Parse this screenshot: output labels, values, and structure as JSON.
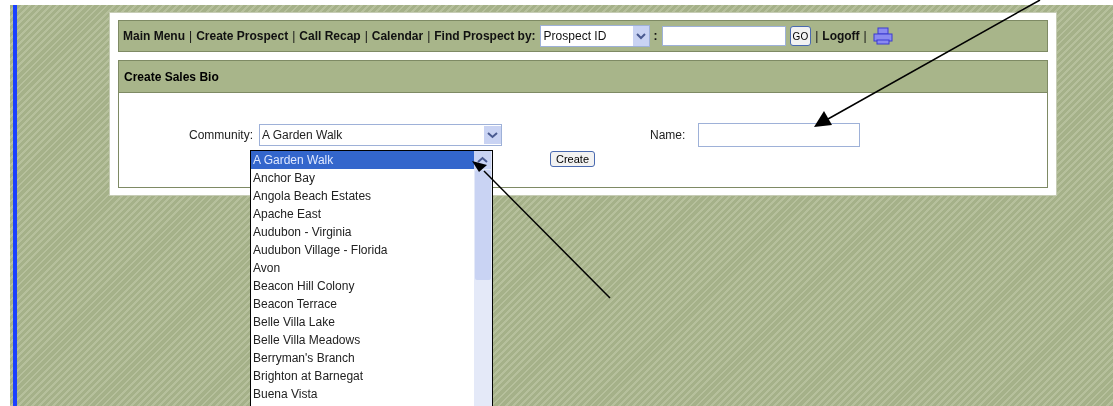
{
  "nav": [
    {
      "kind": "link",
      "text": "Main Menu"
    },
    {
      "kind": "sep",
      "text": "|"
    },
    {
      "kind": "link",
      "text": "Create Prospect"
    },
    {
      "kind": "sep",
      "text": "|"
    },
    {
      "kind": "link",
      "text": "Call Recap"
    },
    {
      "kind": "sep",
      "text": "|"
    },
    {
      "kind": "link",
      "text": "Calendar"
    },
    {
      "kind": "sep",
      "text": "|"
    },
    {
      "kind": "label",
      "text": "Find Prospect by:"
    },
    {
      "kind": "select",
      "text": "Prospect ID"
    },
    {
      "kind": "label",
      "text": ":"
    },
    {
      "kind": "input"
    },
    {
      "kind": "button",
      "text": "GO"
    },
    {
      "kind": "sep",
      "text": "|"
    },
    {
      "kind": "link",
      "text": "Logoff"
    },
    {
      "kind": "sep",
      "text": "|"
    },
    {
      "kind": "icon"
    }
  ],
  "section_title": "Create Sales Bio",
  "community": {
    "label": "Community:",
    "value": "A Garden Walk"
  },
  "name": {
    "label": "Name:"
  },
  "create_button": "Create",
  "community_options": [
    {
      "text": "A Garden Walk",
      "selected": true
    },
    {
      "text": "Anchor Bay",
      "selected": false
    },
    {
      "text": "Angola Beach Estates",
      "selected": false
    },
    {
      "text": "Apache East",
      "selected": false
    },
    {
      "text": "Audubon - Virginia",
      "selected": false
    },
    {
      "text": "Audubon Village - Florida",
      "selected": false
    },
    {
      "text": "Avon",
      "selected": false
    },
    {
      "text": "Beacon Hill Colony",
      "selected": false
    },
    {
      "text": "Beacon Terrace",
      "selected": false
    },
    {
      "text": "Belle Villa Lake",
      "selected": false
    },
    {
      "text": "Belle Villa Meadows",
      "selected": false
    },
    {
      "text": "Berryman's Branch",
      "selected": false
    },
    {
      "text": "Brighton at Barnegat",
      "selected": false
    },
    {
      "text": "Buena Vista",
      "selected": false
    }
  ]
}
